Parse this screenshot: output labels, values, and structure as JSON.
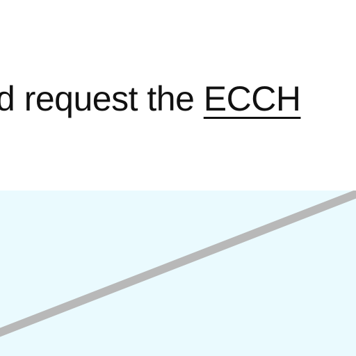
{
  "caption": {
    "prefix": "d request the ",
    "link_text": "ECCH"
  },
  "colors": {
    "page_background": "#ffffff",
    "panel_background": "#eafafe",
    "connector_line": "#b8b8b8",
    "text": "#111111"
  }
}
